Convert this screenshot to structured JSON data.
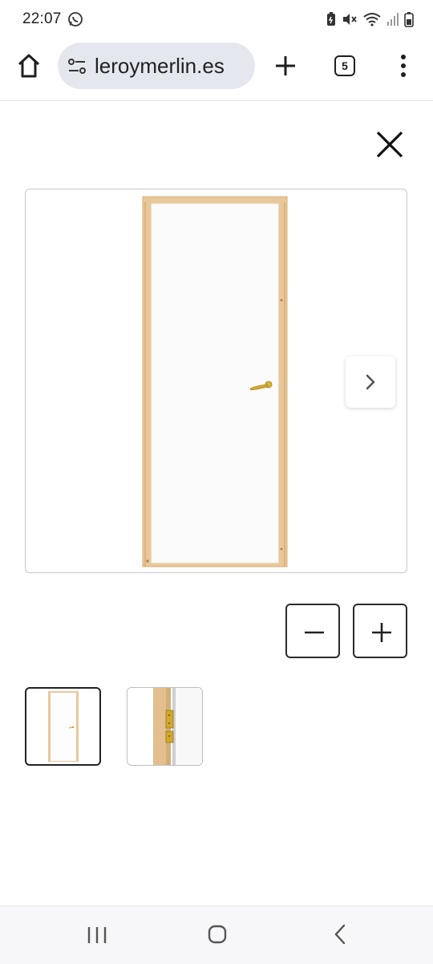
{
  "status_bar": {
    "time": "22:07",
    "icons": [
      "whatsapp-icon",
      "battery-saver-icon",
      "mute-icon",
      "wifi-icon",
      "signal-icon",
      "battery-icon"
    ]
  },
  "browser": {
    "url": "leroymerlin.es",
    "tab_count": "5",
    "icons": [
      "home-icon",
      "site-info-icon",
      "new-tab-icon",
      "tab-switcher-icon",
      "more-vert-icon"
    ]
  },
  "gallery": {
    "icons": [
      "close-icon",
      "chevron-right-icon",
      "minus-icon",
      "plus-icon"
    ],
    "image_subject": "white interior door with pine frame and brass handle",
    "thumbnails": [
      {
        "subject": "door-front",
        "selected": true
      },
      {
        "subject": "door-hinges",
        "selected": false
      }
    ]
  },
  "nav": {
    "icons": [
      "recents-icon",
      "home-circle-icon",
      "back-chevron-icon"
    ]
  },
  "colors": {
    "url_pill": "#e4e7ee",
    "frame_border": "#c9c9c9",
    "pine": "#e8c89a",
    "brass": "#c9a227"
  }
}
